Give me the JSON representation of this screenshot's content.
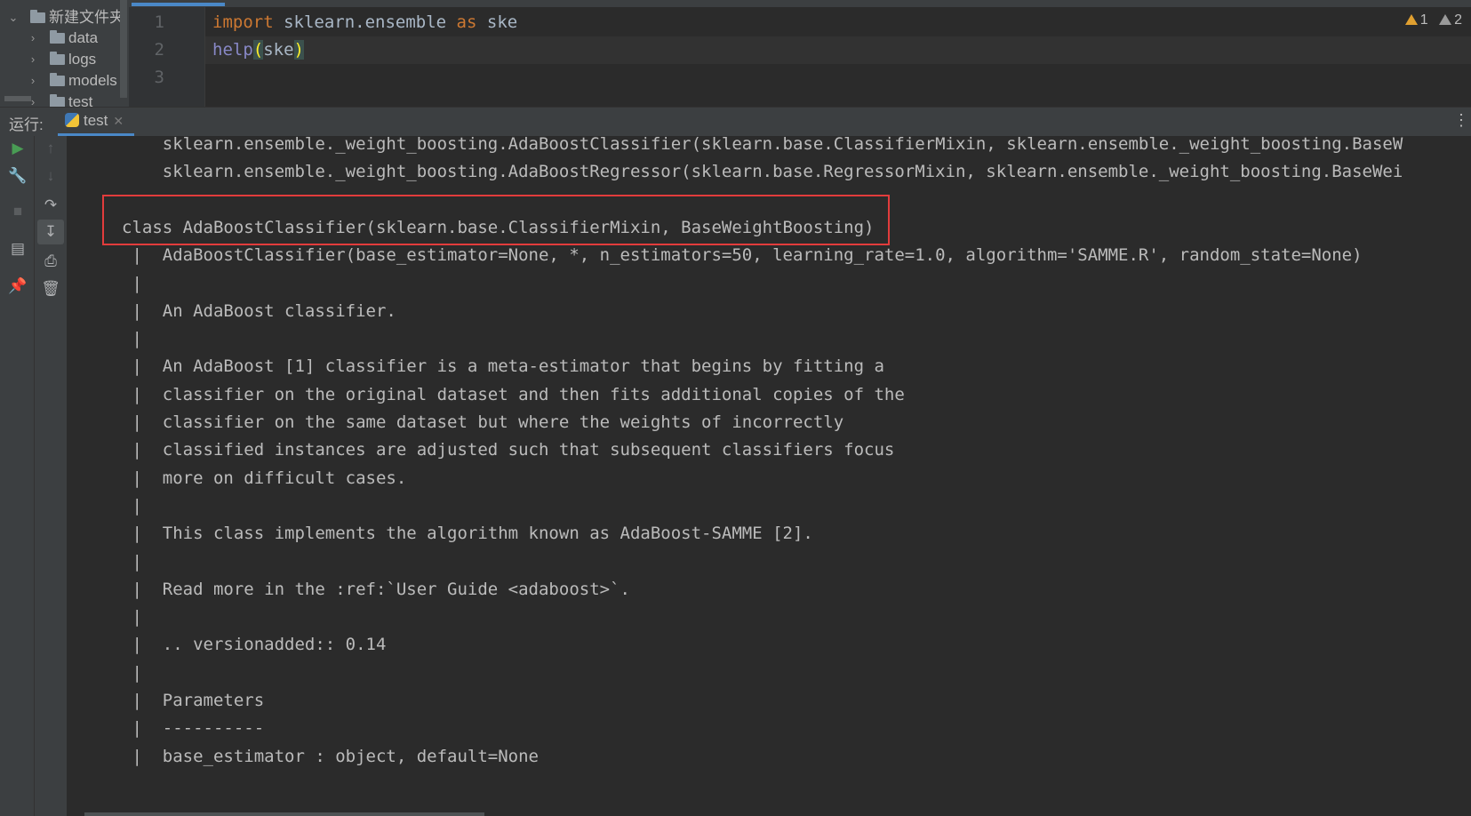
{
  "project_tree": {
    "root": {
      "label": "新建文件夹",
      "expanded": true
    },
    "folders": [
      {
        "label": "data"
      },
      {
        "label": "logs"
      },
      {
        "label": "models"
      },
      {
        "label": "test"
      }
    ]
  },
  "editor": {
    "lines": [
      {
        "number": "1",
        "tokens": [
          {
            "text": "import",
            "kind": "keyword"
          },
          {
            "text": " sklearn.ensemble ",
            "kind": "plain"
          },
          {
            "text": "as",
            "kind": "keyword"
          },
          {
            "text": " ske",
            "kind": "plain"
          }
        ]
      },
      {
        "number": "2",
        "tokens": [
          {
            "text": "help",
            "kind": "builtin"
          },
          {
            "text": "(",
            "kind": "paren"
          },
          {
            "text": "ske",
            "kind": "plain"
          },
          {
            "text": ")",
            "kind": "paren"
          }
        ]
      },
      {
        "number": "3",
        "tokens": []
      }
    ],
    "inspections": {
      "warnings": "1",
      "weak_warnings": "2"
    }
  },
  "run_panel": {
    "label": "运行:",
    "tab_label": "test",
    "console_lines": [
      "    sklearn.ensemble._weight_boosting.AdaBoostClassifier(sklearn.base.ClassifierMixin, sklearn.ensemble._weight_boosting.BaseW",
      "    sklearn.ensemble._weight_boosting.AdaBoostRegressor(sklearn.base.RegressorMixin, sklearn.ensemble._weight_boosting.BaseWei",
      "",
      "class AdaBoostClassifier(sklearn.base.ClassifierMixin, BaseWeightBoosting)",
      " |  AdaBoostClassifier(base_estimator=None, *, n_estimators=50, learning_rate=1.0, algorithm='SAMME.R', random_state=None)",
      " |",
      " |  An AdaBoost classifier.",
      " |",
      " |  An AdaBoost [1] classifier is a meta-estimator that begins by fitting a",
      " |  classifier on the original dataset and then fits additional copies of the",
      " |  classifier on the same dataset but where the weights of incorrectly",
      " |  classified instances are adjusted such that subsequent classifiers focus",
      " |  more on difficult cases.",
      " |",
      " |  This class implements the algorithm known as AdaBoost-SAMME [2].",
      " |",
      " |  Read more in the :ref:`User Guide <adaboost>`.",
      " |",
      " |  .. versionadded:: 0.14",
      " |",
      " |  Parameters",
      " |  ----------",
      " |  base_estimator : object, default=None"
    ]
  },
  "icons": {
    "toolbar1": [
      "run-icon",
      "wrench-icon",
      "stop-icon",
      "layout-icon",
      "pin-icon"
    ],
    "toolbar2": [
      "up-arrow-icon",
      "down-arrow-icon",
      "soft-wrap-icon",
      "scroll-to-end-icon",
      "print-icon",
      "trash-icon"
    ]
  },
  "colors": {
    "keyword": "#cc7832",
    "builtin": "#8888c6",
    "highlight_box": "#e23c3c",
    "run_green": "#499c54",
    "warning": "#e0a030"
  }
}
